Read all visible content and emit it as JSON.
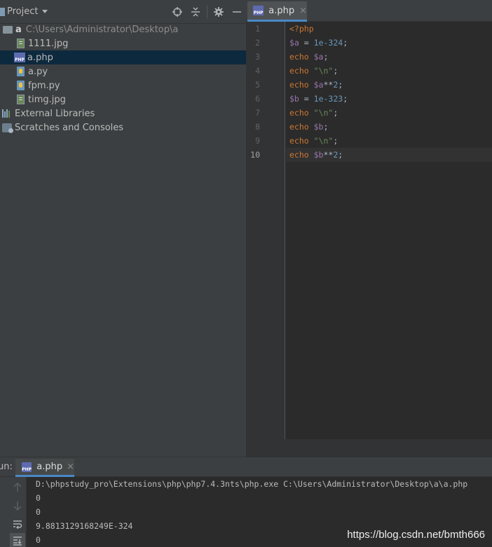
{
  "project": {
    "title": "Project",
    "root_name": "a",
    "root_path": "C:\\Users\\Administrator\\Desktop\\a",
    "files": [
      {
        "label": "1111.jpg",
        "icon": "image-file-icon"
      },
      {
        "label": "a.php",
        "icon": "php-file-icon",
        "selected": true
      },
      {
        "label": "a.py",
        "icon": "python-file-icon"
      },
      {
        "label": "fpm.py",
        "icon": "python-file-icon"
      },
      {
        "label": "timg.jpg",
        "icon": "image-file-icon"
      }
    ],
    "external_libraries": "External Libraries",
    "scratches": "Scratches and Consoles"
  },
  "editor": {
    "tab_label": "a.php",
    "tab_close": "×",
    "file_icon_text": "PHP",
    "current_line": 10,
    "line_numbers": [
      "1",
      "2",
      "3",
      "4",
      "5",
      "6",
      "7",
      "8",
      "9",
      "10"
    ],
    "lines": [
      [
        {
          "t": "kw",
          "v": "<?php"
        }
      ],
      [
        {
          "t": "var",
          "v": "$a"
        },
        {
          "t": "pl",
          "v": " = "
        },
        {
          "t": "num",
          "v": "1e-324"
        },
        {
          "t": "pl",
          "v": ";"
        }
      ],
      [
        {
          "t": "kw",
          "v": "echo "
        },
        {
          "t": "var",
          "v": "$a"
        },
        {
          "t": "pl",
          "v": ";"
        }
      ],
      [
        {
          "t": "kw",
          "v": "echo "
        },
        {
          "t": "str",
          "v": "\"\\n\""
        },
        {
          "t": "pl",
          "v": ";"
        }
      ],
      [
        {
          "t": "kw",
          "v": "echo "
        },
        {
          "t": "var",
          "v": "$a"
        },
        {
          "t": "pl",
          "v": "**"
        },
        {
          "t": "num",
          "v": "2"
        },
        {
          "t": "pl",
          "v": ";"
        }
      ],
      [
        {
          "t": "var",
          "v": "$b"
        },
        {
          "t": "pl",
          "v": " = "
        },
        {
          "t": "num",
          "v": "1e-323"
        },
        {
          "t": "pl",
          "v": ";"
        }
      ],
      [
        {
          "t": "kw",
          "v": "echo "
        },
        {
          "t": "str",
          "v": "\"\\n\""
        },
        {
          "t": "pl",
          "v": ";"
        }
      ],
      [
        {
          "t": "kw",
          "v": "echo "
        },
        {
          "t": "var",
          "v": "$b"
        },
        {
          "t": "pl",
          "v": ";"
        }
      ],
      [
        {
          "t": "kw",
          "v": "echo "
        },
        {
          "t": "str",
          "v": "\"\\n\""
        },
        {
          "t": "pl",
          "v": ";"
        }
      ],
      [
        {
          "t": "kw",
          "v": "echo "
        },
        {
          "t": "var",
          "v": "$b"
        },
        {
          "t": "pl",
          "v": "**"
        },
        {
          "t": "num",
          "v": "2"
        },
        {
          "t": "pl",
          "v": ";"
        }
      ]
    ]
  },
  "run": {
    "label": "un:",
    "tab_label": "a.php",
    "tab_close": "×",
    "output": [
      "D:\\phpstudy_pro\\Extensions\\php\\php7.4.3nts\\php.exe C:\\Users\\Administrator\\Desktop\\a\\a.php",
      "0",
      "0",
      "9.8813129168249E-324",
      "0"
    ]
  },
  "watermark": "https://blog.csdn.net/bmth666",
  "colors": {
    "keyword": "#cc7832",
    "variable": "#9876aa",
    "number": "#6897bb",
    "string": "#6a8759",
    "selection": "#0d293e",
    "tab_underline": "#4a88c7"
  }
}
